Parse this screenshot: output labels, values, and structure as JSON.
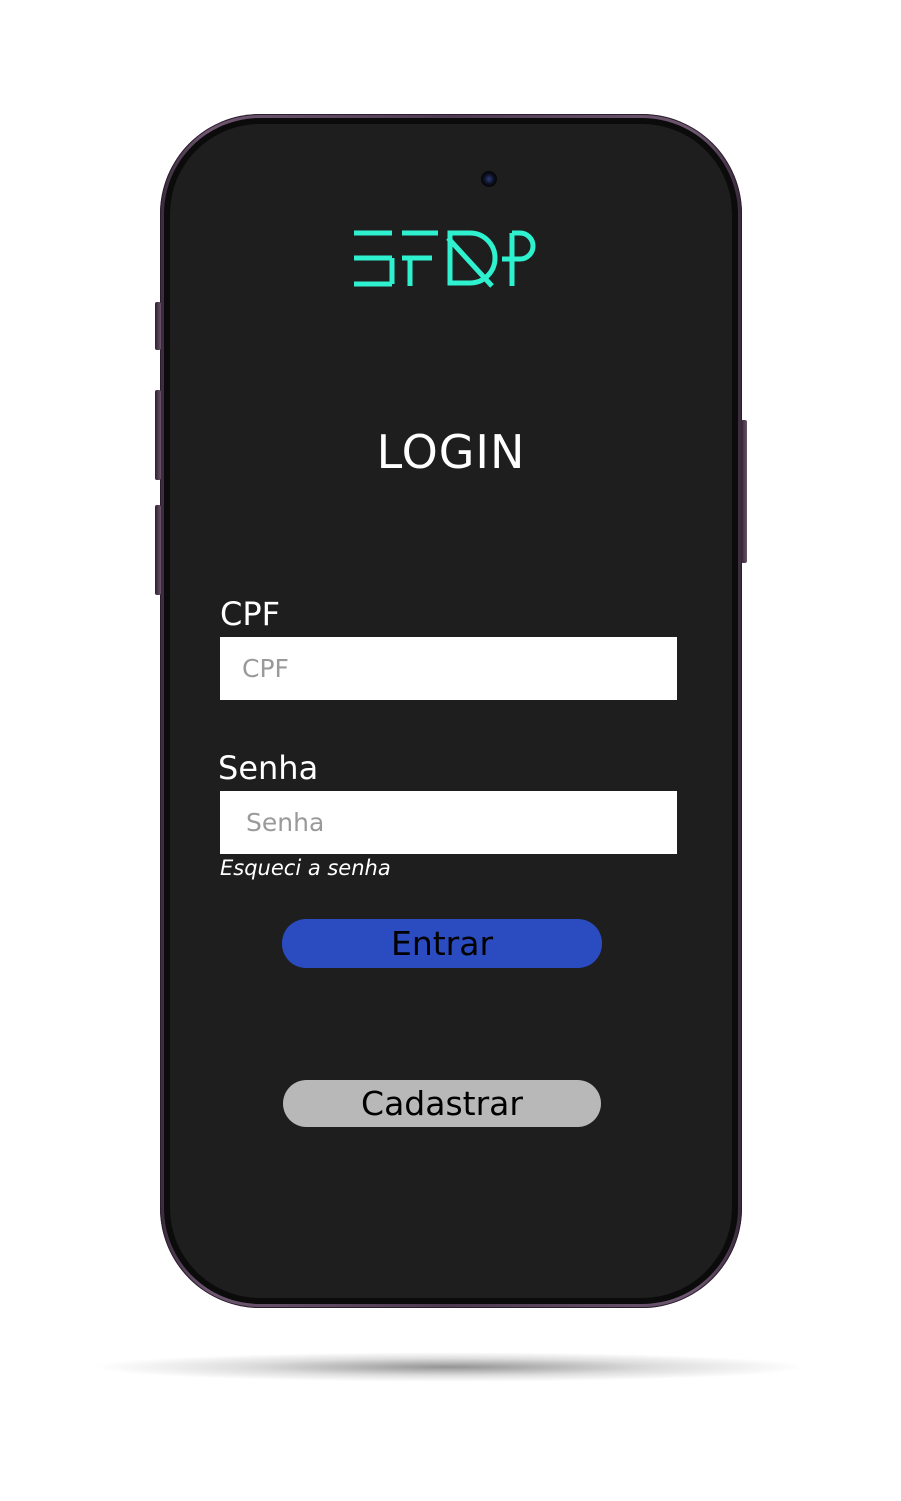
{
  "app": {
    "logo_text": "EFQP",
    "logo_color": "#2ef2cf"
  },
  "login": {
    "title": "LOGIN",
    "cpf": {
      "label": "CPF",
      "placeholder": "CPF",
      "value": ""
    },
    "password": {
      "label": "Senha",
      "placeholder": "Senha",
      "value": ""
    },
    "forgot_password": "Esqueci a senha",
    "enter_button": "Entrar",
    "register_button": "Cadastrar"
  },
  "colors": {
    "screen_background": "#1e1e1e",
    "phone_frame": "#5a4560",
    "enter_button": "#2a4cc0",
    "register_button": "#b8b8b8",
    "input_background": "#ffffff",
    "text": "#ffffff"
  }
}
